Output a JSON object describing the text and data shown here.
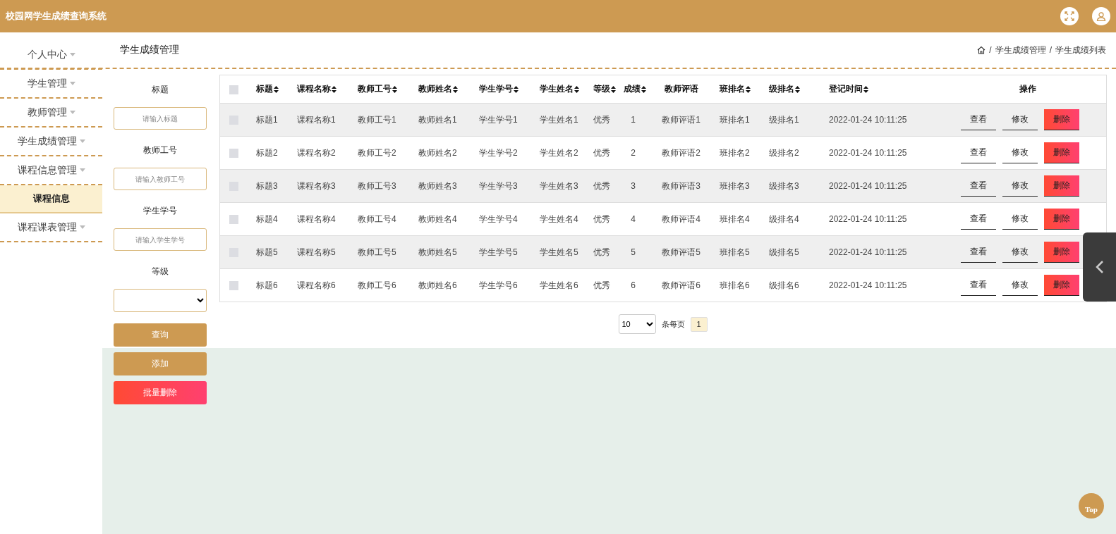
{
  "header": {
    "title": "校园网学生成绩查询系统"
  },
  "sidebar": {
    "items": [
      {
        "label": "个人中心"
      },
      {
        "label": "学生管理"
      },
      {
        "label": "教师管理"
      },
      {
        "label": "学生成绩管理"
      },
      {
        "label": "课程信息管理",
        "children": [
          {
            "label": "课程信息",
            "selected": true
          }
        ]
      },
      {
        "label": "课程课表管理"
      }
    ]
  },
  "page_title": "学生成绩管理",
  "breadcrumb": {
    "separator": "/",
    "items": [
      "学生成绩管理",
      "学生成绩列表"
    ]
  },
  "filters": [
    {
      "kind": "text",
      "label": "标题",
      "placeholder": "请输入标题"
    },
    {
      "kind": "text",
      "label": "教师工号",
      "placeholder": "请输入教师工号"
    },
    {
      "kind": "text",
      "label": "学生学号",
      "placeholder": "请输入学生学号"
    },
    {
      "kind": "select",
      "label": "等级"
    }
  ],
  "filter_buttons": [
    {
      "kind": "primary",
      "label": "查询"
    },
    {
      "kind": "primary",
      "label": "添加"
    },
    {
      "kind": "danger",
      "label": "批量删除"
    }
  ],
  "table": {
    "all_checked": false,
    "columns": [
      {
        "label": "标题",
        "sortable": true
      },
      {
        "label": "课程名称",
        "sortable": true
      },
      {
        "label": "教师工号",
        "sortable": true
      },
      {
        "label": "教师姓名",
        "sortable": true
      },
      {
        "label": "学生学号",
        "sortable": true
      },
      {
        "label": "学生姓名",
        "sortable": true
      },
      {
        "label": "等级",
        "sortable": true
      },
      {
        "label": "成绩",
        "sortable": true
      },
      {
        "label": "教师评语",
        "sortable": false
      },
      {
        "label": "班排名",
        "sortable": true
      },
      {
        "label": "级排名",
        "sortable": true
      },
      {
        "label": "登记时间",
        "sortable": true
      },
      {
        "label": "操作",
        "sortable": false
      }
    ],
    "rows": [
      {
        "checked": false,
        "cells": [
          "标题1",
          "课程名称1",
          "教师工号1",
          "教师姓名1",
          "学生学号1",
          "学生姓名1",
          "优秀",
          "1",
          "教师评语1",
          "班排名1",
          "级排名1",
          "2022-01-24 10:11:25"
        ],
        "actions": [
          {
            "kind": "plain",
            "label": "查看"
          },
          {
            "kind": "plain",
            "label": "修改"
          },
          {
            "kind": "danger",
            "label": "删除"
          }
        ]
      },
      {
        "checked": false,
        "cells": [
          "标题2",
          "课程名称2",
          "教师工号2",
          "教师姓名2",
          "学生学号2",
          "学生姓名2",
          "优秀",
          "2",
          "教师评语2",
          "班排名2",
          "级排名2",
          "2022-01-24 10:11:25"
        ],
        "actions": [
          {
            "kind": "plain",
            "label": "查看"
          },
          {
            "kind": "plain",
            "label": "修改"
          },
          {
            "kind": "danger",
            "label": "删除"
          }
        ]
      },
      {
        "checked": false,
        "cells": [
          "标题3",
          "课程名称3",
          "教师工号3",
          "教师姓名3",
          "学生学号3",
          "学生姓名3",
          "优秀",
          "3",
          "教师评语3",
          "班排名3",
          "级排名3",
          "2022-01-24 10:11:25"
        ],
        "actions": [
          {
            "kind": "plain",
            "label": "查看"
          },
          {
            "kind": "plain",
            "label": "修改"
          },
          {
            "kind": "danger",
            "label": "删除"
          }
        ]
      },
      {
        "checked": false,
        "cells": [
          "标题4",
          "课程名称4",
          "教师工号4",
          "教师姓名4",
          "学生学号4",
          "学生姓名4",
          "优秀",
          "4",
          "教师评语4",
          "班排名4",
          "级排名4",
          "2022-01-24 10:11:25"
        ],
        "actions": [
          {
            "kind": "plain",
            "label": "查看"
          },
          {
            "kind": "plain",
            "label": "修改"
          },
          {
            "kind": "danger",
            "label": "删除"
          }
        ]
      },
      {
        "checked": false,
        "cells": [
          "标题5",
          "课程名称5",
          "教师工号5",
          "教师姓名5",
          "学生学号5",
          "学生姓名5",
          "优秀",
          "5",
          "教师评语5",
          "班排名5",
          "级排名5",
          "2022-01-24 10:11:25"
        ],
        "actions": [
          {
            "kind": "plain",
            "label": "查看"
          },
          {
            "kind": "plain",
            "label": "修改"
          },
          {
            "kind": "danger",
            "label": "删除"
          }
        ]
      },
      {
        "checked": false,
        "cells": [
          "标题6",
          "课程名称6",
          "教师工号6",
          "教师姓名6",
          "学生学号6",
          "学生姓名6",
          "优秀",
          "6",
          "教师评语6",
          "班排名6",
          "级排名6",
          "2022-01-24 10:11:25"
        ],
        "actions": [
          {
            "kind": "plain",
            "label": "查看"
          },
          {
            "kind": "plain",
            "label": "修改"
          },
          {
            "kind": "danger",
            "label": "删除"
          }
        ]
      }
    ]
  },
  "pagination": {
    "page_size": "10",
    "per_page_label": "条每页",
    "pages": [
      {
        "label": "1",
        "selected": true
      }
    ]
  },
  "back_to_top": "Top"
}
